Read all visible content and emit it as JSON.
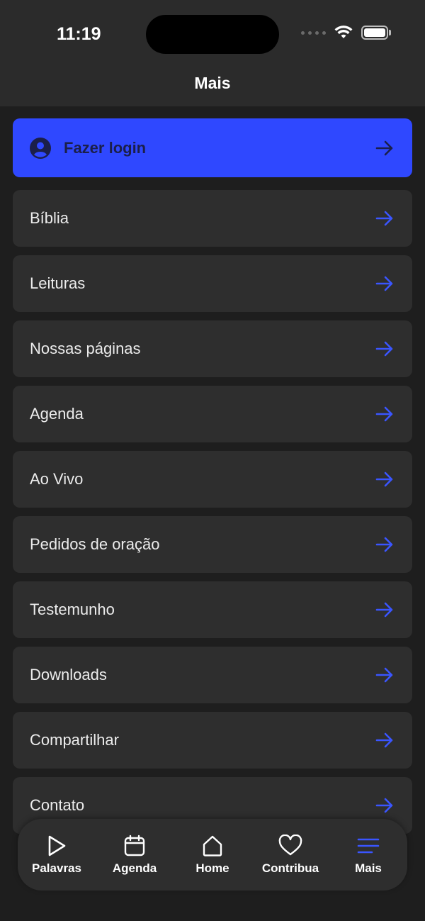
{
  "status": {
    "time": "11:19"
  },
  "header": {
    "title": "Mais"
  },
  "login": {
    "label": "Fazer login"
  },
  "menu": [
    {
      "label": "Bíblia"
    },
    {
      "label": "Leituras"
    },
    {
      "label": "Nossas páginas"
    },
    {
      "label": "Agenda"
    },
    {
      "label": "Ao Vivo"
    },
    {
      "label": "Pedidos de oração"
    },
    {
      "label": "Testemunho"
    },
    {
      "label": "Downloads"
    },
    {
      "label": "Compartilhar"
    },
    {
      "label": "Contato"
    }
  ],
  "tabs": [
    {
      "label": "Palavras",
      "icon": "play-icon"
    },
    {
      "label": "Agenda",
      "icon": "calendar-icon"
    },
    {
      "label": "Home",
      "icon": "home-icon"
    },
    {
      "label": "Contribua",
      "icon": "heart-icon"
    },
    {
      "label": "Mais",
      "icon": "menu-icon",
      "active": true
    }
  ],
  "colors": {
    "accent": "#2f48ff",
    "arrow": "#3a55ff",
    "background": "#1e1e1e",
    "card": "#2e2e2e"
  }
}
